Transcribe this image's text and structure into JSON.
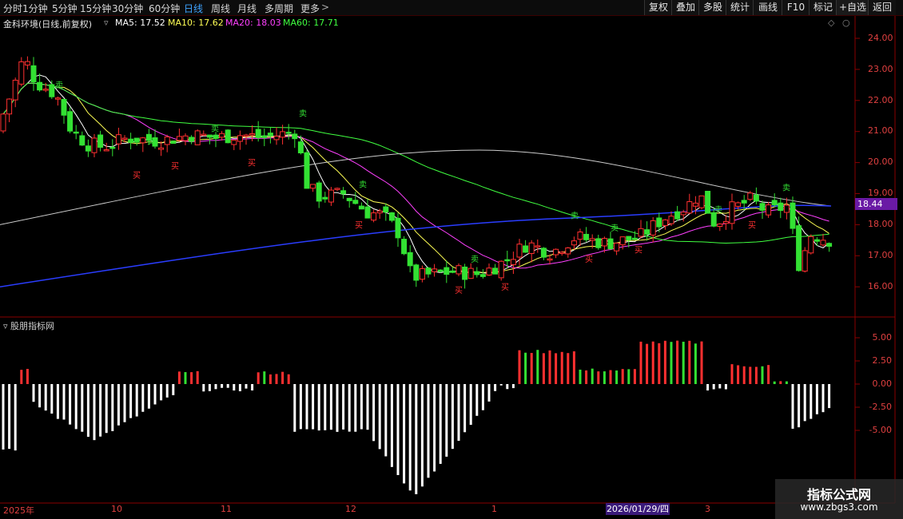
{
  "toolbar": {
    "periods": [
      "分时",
      "1分钟",
      "5分钟",
      "15分钟",
      "30分钟",
      "60分钟",
      "日线",
      "周线",
      "月线",
      "多周期",
      "更多"
    ],
    "active_period": "日线",
    "right_buttons": [
      "复权",
      "叠加",
      "多股",
      "统计",
      "画线",
      "F10",
      "标记",
      "+自选",
      "返回"
    ]
  },
  "stock": {
    "title": "金科环境(日线,前复权)",
    "ma_labels": [
      "MA5: 17.52",
      "MA10: 17.62",
      "MA20: 18.03",
      "MA60: 17.71"
    ],
    "ma_colors": [
      "#ffffff",
      "#ffff55",
      "#ff40ff",
      "#40ff40"
    ]
  },
  "price_axis": [
    "24.00",
    "23.00",
    "22.00",
    "21.00",
    "20.00",
    "19.00",
    "18.00",
    "17.00",
    "16.00"
  ],
  "current_price": "18.44",
  "indicator": {
    "title": "股朋指标网",
    "axis": [
      "5.00",
      "2.50",
      "0.00",
      "-2.50",
      "-5.00"
    ]
  },
  "time_axis": [
    "2025年",
    "10",
    "11",
    "12",
    "1",
    "3"
  ],
  "cursor_date": "2026/01/29/四",
  "watermark": {
    "line1": "指标公式网",
    "line2": "www.zbgs3.com"
  },
  "candle_signals": {
    "buy": "买",
    "sell": "卖"
  }
}
